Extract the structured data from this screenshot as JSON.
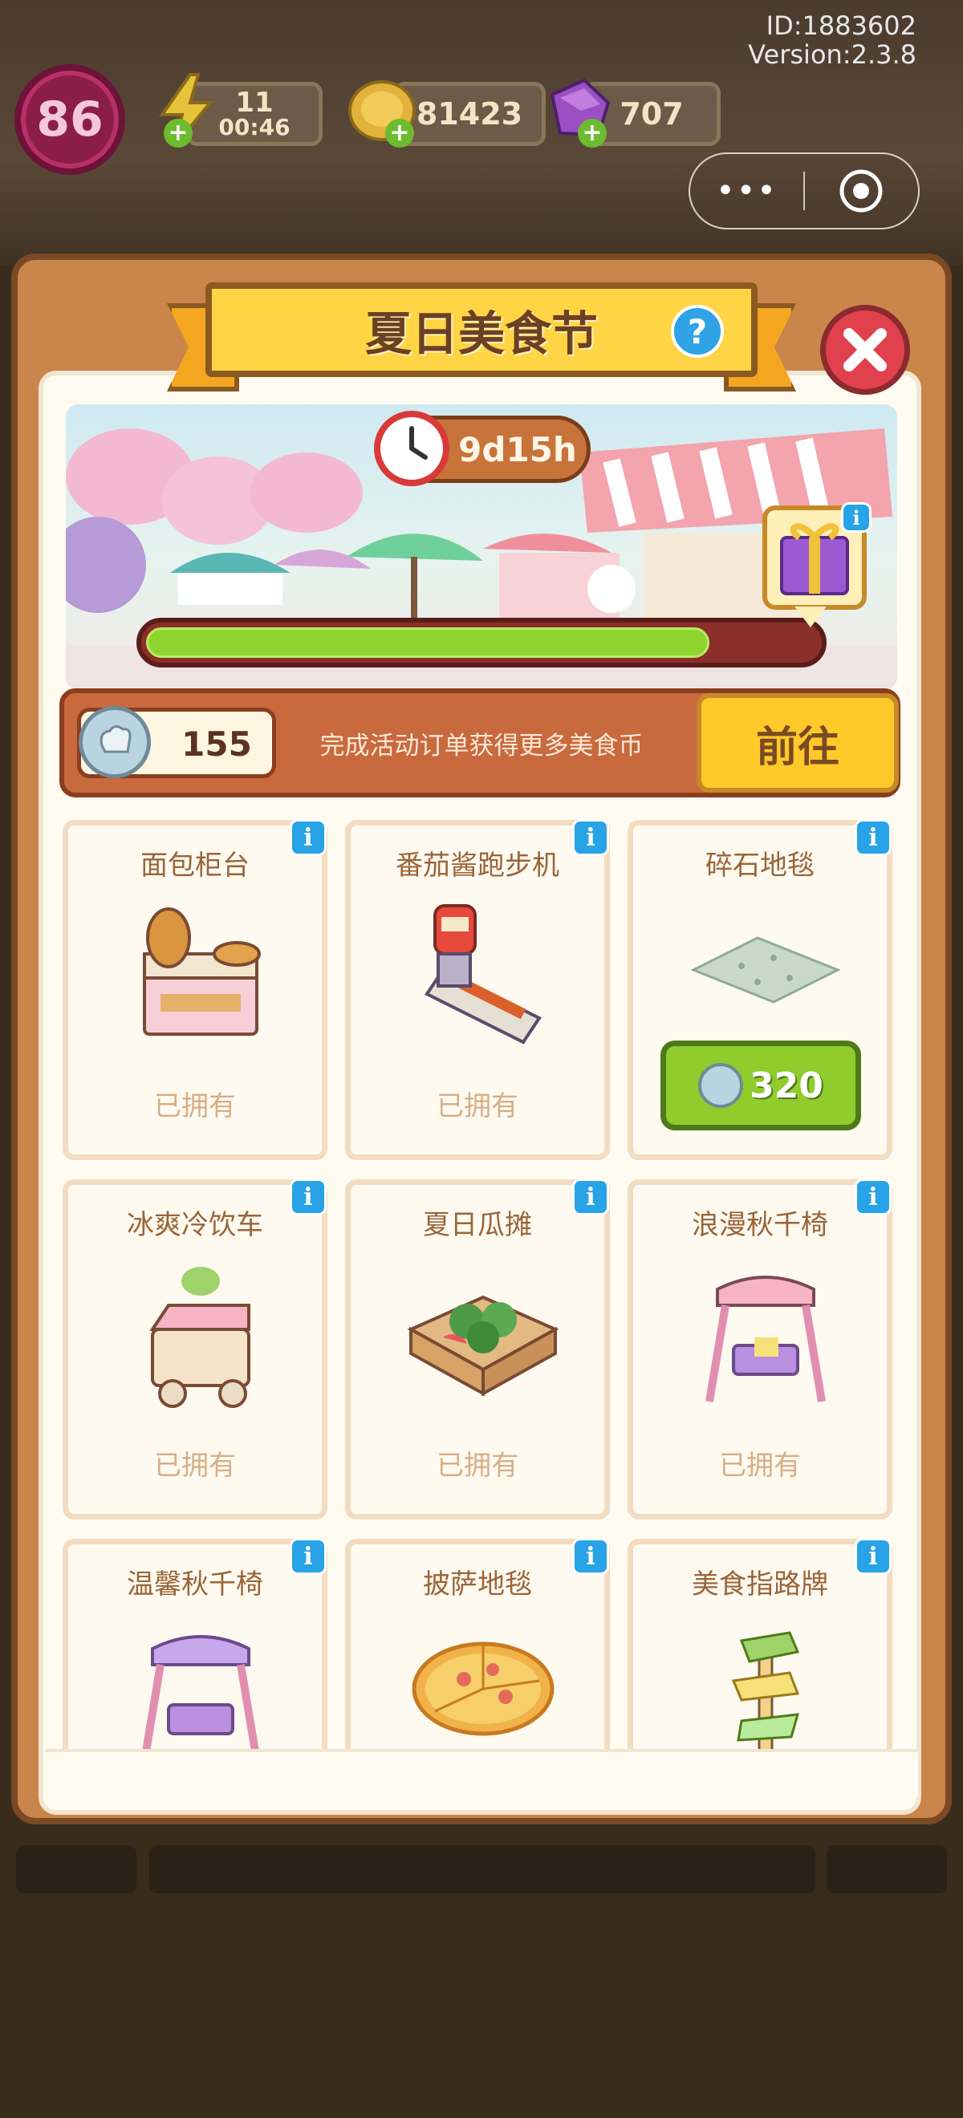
{
  "header": {
    "id_text": "ID:1883602",
    "version_text": "Version:2.3.8"
  },
  "hud": {
    "level": "86",
    "energy": "11",
    "energy_timer": "00:46",
    "coins": "81423",
    "gems": "707",
    "icons": {
      "energy": "lightning-icon",
      "coins": "gold-coin-icon",
      "gems": "purple-gem-icon",
      "add": "plus-icon"
    }
  },
  "capsule": {
    "more_label": "•••",
    "close_icon": "target-icon"
  },
  "panel": {
    "title": "夏日美食节",
    "help_label": "?",
    "close_label": "✕"
  },
  "event": {
    "timer": "9d15h",
    "progress": 0.84,
    "gift_icon": "gift-box-icon"
  },
  "currency": {
    "count": "155",
    "hint": "完成活动订单获得更多美食币",
    "goto_label": "前往"
  },
  "items": [
    {
      "name": "面包柜台",
      "status": "已拥有",
      "art": "bread-counter-icon"
    },
    {
      "name": "番茄酱跑步机",
      "status": "已拥有",
      "art": "ketchup-treadmill-icon"
    },
    {
      "name": "碎石地毯",
      "status": "",
      "price": "320",
      "art": "gravel-rug-icon"
    },
    {
      "name": "冰爽冷饮车",
      "status": "已拥有",
      "art": "drink-cart-icon"
    },
    {
      "name": "夏日瓜摊",
      "status": "已拥有",
      "art": "melon-stand-icon"
    },
    {
      "name": "浪漫秋千椅",
      "status": "已拥有",
      "art": "pink-swing-icon"
    },
    {
      "name": "温馨秋千椅",
      "status": "",
      "art": "purple-swing-icon"
    },
    {
      "name": "披萨地毯",
      "status": "",
      "art": "pizza-rug-icon"
    },
    {
      "name": "美食指路牌",
      "status": "",
      "art": "signpost-icon"
    }
  ],
  "info_label": "i",
  "colors": {
    "panel": "#c9854a",
    "title_banner": "#ffd545",
    "progress": "#8fd32f",
    "buy_button": "#8fcc2c",
    "info": "#27a3e6",
    "close": "#e0414c"
  }
}
